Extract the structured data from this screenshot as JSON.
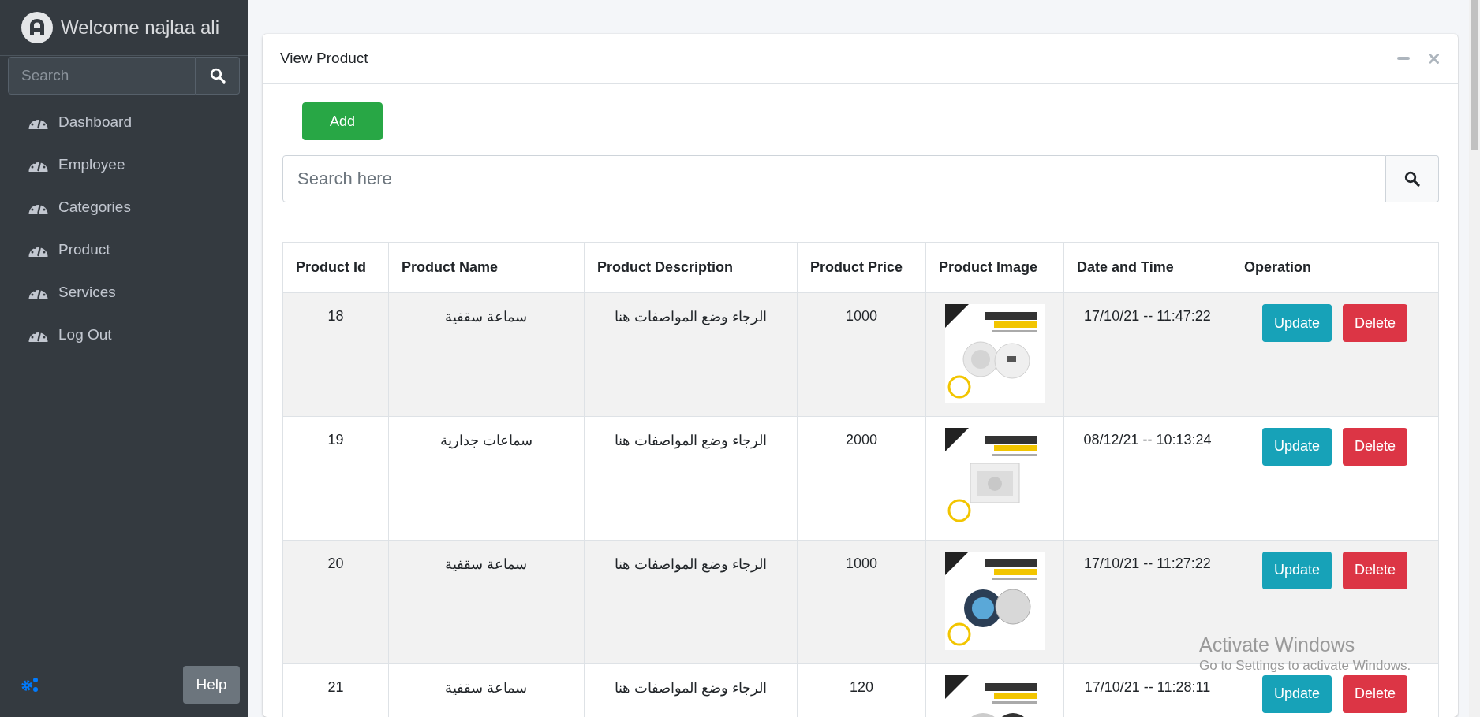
{
  "sidebar": {
    "user": "Welcome najlaa ali",
    "search": {
      "placeholder": "Search"
    },
    "items": [
      {
        "label": "Dashboard"
      },
      {
        "label": "Employee"
      },
      {
        "label": "Categories"
      },
      {
        "label": "Product"
      },
      {
        "label": "Services"
      },
      {
        "label": "Log Out"
      }
    ],
    "help": "Help"
  },
  "card": {
    "title": "View Product",
    "add": "Add",
    "search": {
      "placeholder": "Search here"
    },
    "table": {
      "columns": [
        "Product Id",
        "Product Name",
        "Product Description",
        "Product Price",
        "Product Image",
        "Date and Time",
        "Operation"
      ],
      "rows": [
        {
          "id": "18",
          "name": "سماعة سقفية",
          "description": "الرجاء وضع المواصفات هنا",
          "price": "1000",
          "datetime": "17/10/21 -- 11:47:22",
          "actions": [
            {
              "label": "Update",
              "kind": "info"
            },
            {
              "label": "Delete",
              "kind": "danger"
            }
          ]
        },
        {
          "id": "19",
          "name": "سماعات جدارية",
          "description": "الرجاء وضع المواصفات هنا",
          "price": "2000",
          "datetime": "08/12/21 -- 10:13:24",
          "actions": [
            {
              "label": "Update",
              "kind": "info"
            },
            {
              "label": "Delete",
              "kind": "danger"
            }
          ]
        },
        {
          "id": "20",
          "name": "سماعة سقفية",
          "description": "الرجاء وضع المواصفات هنا",
          "price": "1000",
          "datetime": "17/10/21 -- 11:27:22",
          "actions": [
            {
              "label": "Update",
              "kind": "info"
            },
            {
              "label": "Delete",
              "kind": "danger"
            }
          ]
        },
        {
          "id": "21",
          "name": "سماعة سقفية",
          "description": "الرجاء وضع المواصفات هنا",
          "price": "120",
          "datetime": "17/10/21 -- 11:28:11",
          "actions": [
            {
              "label": "Update",
              "kind": "info"
            },
            {
              "label": "Delete",
              "kind": "danger"
            }
          ]
        }
      ]
    }
  },
  "os_notice": {
    "title": "Activate Windows",
    "text": "Go to Settings to activate Windows."
  }
}
